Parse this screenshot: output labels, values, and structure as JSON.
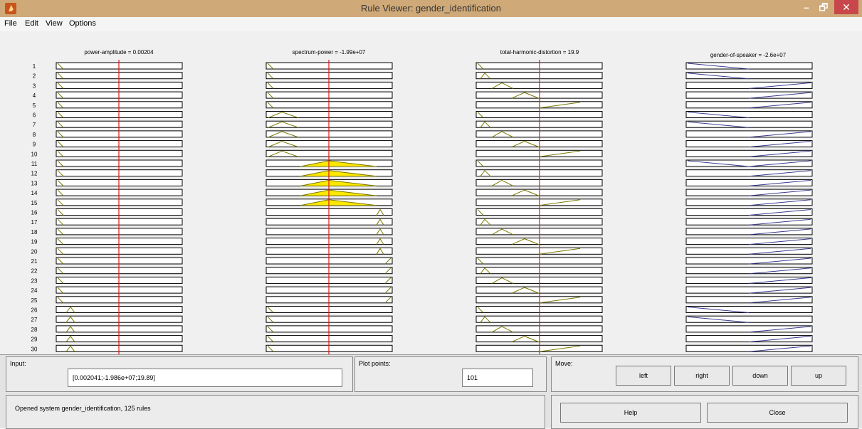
{
  "window": {
    "title": "Rule Viewer: gender_identification",
    "minimize": "–",
    "maximize": "🗗",
    "close": "✕"
  },
  "menu": [
    "File",
    "Edit",
    "View",
    "Options"
  ],
  "plot": {
    "variable_titles": [
      "power-amplitude = 0.00204",
      "spectrum-power = -1.99e+07",
      "total-harmonic-distortion = 19.9",
      "gender-of-speaker = -2.6e+07"
    ],
    "rule_numbers": [
      "1",
      "2",
      "3",
      "4",
      "5",
      "6",
      "7",
      "8",
      "9",
      "10",
      "11",
      "12",
      "13",
      "14",
      "15",
      "16",
      "17",
      "18",
      "19",
      "20",
      "21",
      "22",
      "23",
      "24",
      "25",
      "26",
      "27",
      "28",
      "29",
      "30"
    ],
    "active_rules": [
      11,
      12,
      13,
      14,
      15
    ],
    "colors": {
      "input_mf": "#787800",
      "output_mf": "#3a3a90",
      "fired_fill": "#ffe800",
      "indicator": "#e01818",
      "row_border": "#000000"
    }
  },
  "controls": {
    "input_label": "Input:",
    "input_value": "[0.002041;-1.986e+07;19.89]",
    "plot_points_label": "Plot points:",
    "plot_points_value": "101",
    "move_label": "Move:",
    "left": "left",
    "right": "right",
    "down": "down",
    "up": "up",
    "status": "Opened system gender_identification, 125 rules",
    "help": "Help",
    "close": "Close"
  }
}
